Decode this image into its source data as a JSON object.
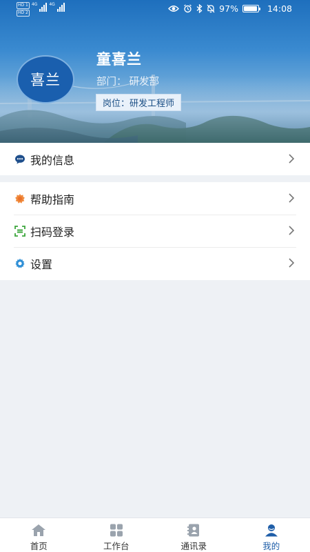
{
  "status_bar": {
    "sim1_tag": "HD 1",
    "sim2_tag": "HD 2",
    "network_1": "4G",
    "network_2": "4G",
    "battery": "97%",
    "battery_level": 0.97,
    "time": "14:08"
  },
  "profile": {
    "avatar_text": "喜兰",
    "name": "童喜兰",
    "department_label": "部门：",
    "department": "研发部",
    "position_label": "岗位：",
    "position": "研发工程师"
  },
  "menu": {
    "my_info": {
      "label": "我的信息",
      "icon": "chat-bubble-icon"
    },
    "help": {
      "label": "帮助指南",
      "icon": "help-icon"
    },
    "scan_login": {
      "label": "扫码登录",
      "icon": "scan-icon"
    },
    "settings": {
      "label": "设置",
      "icon": "gear-icon"
    }
  },
  "tabbar": {
    "tabs": [
      {
        "label": "首页",
        "icon": "home-icon"
      },
      {
        "label": "工作台",
        "icon": "grid-icon"
      },
      {
        "label": "通讯录",
        "icon": "contacts-icon"
      },
      {
        "label": "我的",
        "icon": "user-icon"
      }
    ],
    "active_index": 3
  },
  "colors": {
    "accent": "#1f5ea8",
    "inactive_icon": "#9aa3ad",
    "background": "#eef1f5"
  }
}
